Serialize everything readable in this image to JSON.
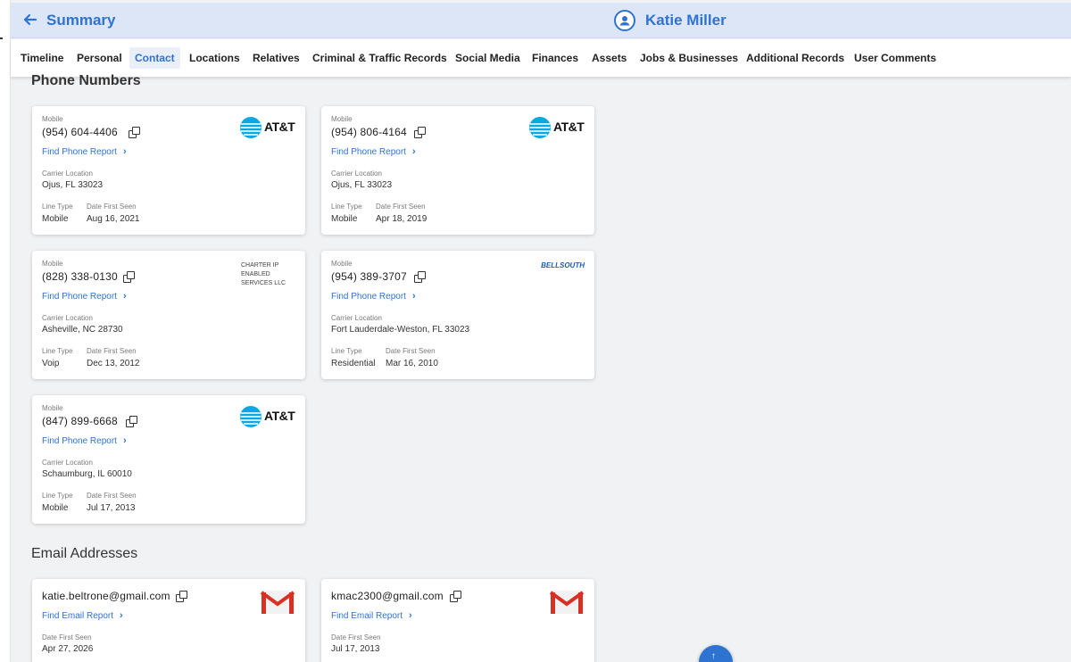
{
  "header": {
    "back_label": "Summary",
    "user_name": "Katie Miller"
  },
  "nav": {
    "items": [
      "Timeline",
      "Personal",
      "Contact",
      "Locations",
      "Relatives",
      "Criminal & Traffic Records",
      "Social Media",
      "Finances",
      "Assets",
      "Jobs & Businesses",
      "Additional Records",
      "User Comments"
    ],
    "active": "Contact"
  },
  "phones": {
    "section_title": "Phone Numbers",
    "labels": {
      "type": "Mobile",
      "carrier_location": "Carrier Location",
      "line_type": "Line Type",
      "date_first_seen": "Date First Seen",
      "report_link": "Find Phone Report"
    },
    "items": [
      {
        "number": "(954) 604-4406",
        "carrier": "AT&T",
        "location": "Ojus, FL 33023",
        "line_type": "Mobile",
        "first_seen": "Aug 16, 2021"
      },
      {
        "number": "(954) 806-4164",
        "carrier": "AT&T",
        "location": "Ojus, FL 33023",
        "line_type": "Mobile",
        "first_seen": "Apr 18, 2019"
      },
      {
        "number": "(828) 338-0130",
        "carrier": "CHARTER IP ENABLED SERVICES LLC",
        "location": "Asheville, NC 28730",
        "line_type": "Voip",
        "first_seen": "Dec 13, 2012"
      },
      {
        "number": "(954) 389-3707",
        "carrier": "BELLSOUTH",
        "location": "Fort Lauderdale-Weston, FL 33023",
        "line_type": "Residential",
        "first_seen": "Mar 16, 2010"
      },
      {
        "number": "(847) 899-6668",
        "carrier": "AT&T",
        "location": "Schaumburg, IL 60010",
        "line_type": "Mobile",
        "first_seen": "Jul 17, 2013"
      }
    ]
  },
  "emails": {
    "section_title": "Email Addresses",
    "labels": {
      "report_link": "Find Email Report",
      "date_first_seen": "Date First Seen"
    },
    "items": [
      {
        "address": "katie.beltrone@gmail.com",
        "first_seen": "Apr 27, 2026"
      },
      {
        "address": "kmac2300@gmail.com",
        "first_seen": "Jul 17, 2013"
      }
    ]
  },
  "colors": {
    "accent": "#2f73d1",
    "header_bg": "#dde6f7",
    "page_bg": "#f1f2f4"
  },
  "icons": {
    "back": "arrow-left-icon",
    "user": "user-circle-icon",
    "copy": "copy-icon",
    "chevron": "chevron-right-icon",
    "scroll_top": "arrow-up-icon"
  }
}
